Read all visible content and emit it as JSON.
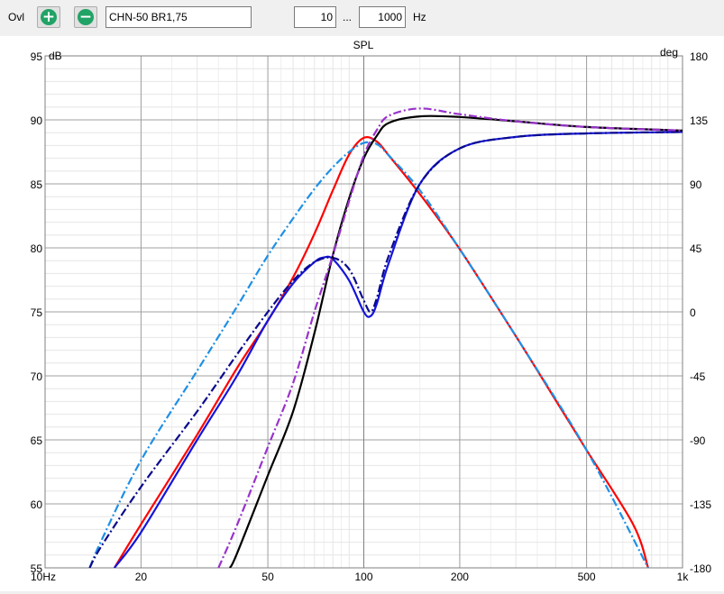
{
  "toolbar": {
    "label": "Ovl",
    "add_icon": "plus-icon",
    "remove_icon": "minus-icon",
    "overlay_name": "CHN-50 BR1,75",
    "freq_from": "10",
    "range_sep": "...",
    "freq_to": "1000",
    "unit": "Hz"
  },
  "chart_data": {
    "type": "line",
    "title": "SPL",
    "ylabel": "dB",
    "y2label": "deg",
    "xscale": "log",
    "xlim": [
      10,
      1000
    ],
    "ylim": [
      55,
      95
    ],
    "y2lim": [
      -180,
      180
    ],
    "grid": true,
    "xticks": [
      {
        "value": 10,
        "label": "10Hz"
      },
      {
        "value": 20,
        "label": "20"
      },
      {
        "value": 50,
        "label": "50"
      },
      {
        "value": 100,
        "label": "100"
      },
      {
        "value": 200,
        "label": "200"
      },
      {
        "value": 500,
        "label": "500"
      },
      {
        "value": 1000,
        "label": "1k"
      }
    ],
    "yticks": [
      95,
      90,
      85,
      80,
      75,
      70,
      65,
      60,
      55
    ],
    "y2ticks": [
      180,
      135,
      90,
      45,
      0,
      -45,
      -90,
      -135,
      -180
    ],
    "series": [
      {
        "color": "#ff0000",
        "dash": "solid",
        "axis": "left",
        "x": [
          16.5,
          20,
          30,
          40,
          50,
          60,
          70,
          80,
          90,
          100,
          110,
          120,
          150,
          200,
          300,
          400,
          500,
          700,
          780
        ],
        "y": [
          55,
          58.4,
          65.4,
          70.6,
          74.3,
          77.7,
          81.1,
          84.5,
          87.3,
          88.6,
          88.3,
          87.2,
          84.2,
          79.9,
          73.1,
          68.1,
          64.2,
          58.4,
          55
        ]
      },
      {
        "color": "#1e90e6",
        "dash": "dashdot",
        "axis": "left",
        "x": [
          13.8,
          15,
          20,
          30,
          40,
          50,
          60,
          70,
          80,
          90,
          100,
          110,
          120,
          150,
          200,
          300,
          500,
          780
        ],
        "y": [
          55,
          57.1,
          63.4,
          70.4,
          75.4,
          79.4,
          82.3,
          84.6,
          86.3,
          87.5,
          88.2,
          88.1,
          87.2,
          84.5,
          79.9,
          73.1,
          64.2,
          55
        ]
      },
      {
        "color": "#1414dc",
        "dash": "solid",
        "axis": "right",
        "x": [
          16.5,
          20,
          30,
          40,
          50,
          60,
          70,
          75,
          80,
          90,
          100,
          105,
          110,
          120,
          150,
          200,
          300,
          500,
          1000
        ],
        "y": [
          -180,
          -155,
          -90,
          -45,
          -6,
          20,
          35,
          38.3,
          37,
          22,
          0,
          -3,
          6,
          35,
          90,
          115,
          123,
          125.5,
          126.5
        ]
      },
      {
        "color": "#0a0a8c",
        "dash": "dashdot",
        "axis": "right",
        "x": [
          13.8,
          15,
          20,
          30,
          40,
          50,
          60,
          70,
          80,
          90,
          100,
          105,
          110,
          120,
          150,
          200,
          300,
          500,
          1000
        ],
        "y": [
          -180,
          -165,
          -123,
          -70,
          -30,
          0,
          22,
          35,
          38,
          30,
          8,
          0,
          10,
          40,
          90,
          115,
          123,
          125.5,
          126.5
        ]
      },
      {
        "color": "#000000",
        "dash": "solid",
        "axis": "right",
        "x": [
          38,
          40,
          50,
          60,
          70,
          80,
          90,
          100,
          110,
          120,
          150,
          200,
          300,
          500,
          1000
        ],
        "y": [
          -180,
          -170,
          -115,
          -70,
          -15,
          40,
          80,
          108,
          124,
          133,
          137.5,
          137,
          134,
          130,
          127.5
        ]
      },
      {
        "color": "#9932cc",
        "dash": "dashdot",
        "axis": "right",
        "x": [
          35,
          40,
          50,
          60,
          70,
          80,
          90,
          100,
          110,
          120,
          150,
          200,
          300,
          500,
          1000
        ],
        "y": [
          -180,
          -150,
          -95,
          -50,
          0,
          40,
          78,
          110,
          128,
          138,
          143,
          139,
          134,
          130,
          127.5
        ]
      }
    ]
  }
}
